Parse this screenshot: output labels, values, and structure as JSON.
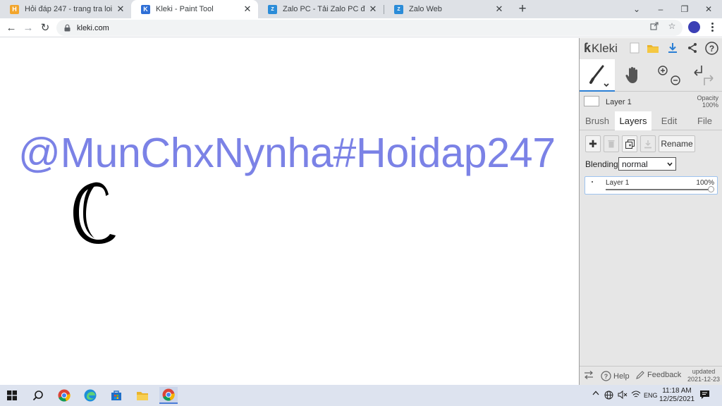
{
  "browser": {
    "tabs": [
      {
        "title": "Hỏi đáp 247 - trang tra loi",
        "active": false,
        "icon": "hoidap-favicon"
      },
      {
        "title": "Kleki - Paint Tool",
        "active": true,
        "icon": "kleki-favicon"
      },
      {
        "title": "Zalo PC - Tải Zalo PC để làm việc",
        "active": false,
        "icon": "zalo-favicon"
      },
      {
        "title": "Zalo Web",
        "active": false,
        "icon": "zalo-favicon"
      }
    ],
    "url": "kleki.com",
    "window_controls": {
      "tab_search": "⌄",
      "minimize": "–",
      "restore": "❐",
      "close": "✕"
    },
    "nav": {
      "back": "←",
      "forward": "→",
      "reload": "↻"
    }
  },
  "canvas": {
    "text": "@MunChxNynha#Hoidap247",
    "text_color": "#7b82e6",
    "stroke_color": "#000000"
  },
  "kleki": {
    "logo_text": "Kleki",
    "header_icons": [
      "new-image-icon",
      "open-folder-icon",
      "download-icon",
      "share-icon",
      "help-icon"
    ],
    "active_layer_name": "Layer 1",
    "opacity_label": "Opacity",
    "opacity_value": "100%",
    "tabs": [
      "Brush",
      "Layers",
      "Edit",
      "File"
    ],
    "active_tab": "Layers",
    "layer_buttons": {
      "rename": "Rename"
    },
    "blending_label": "Blending",
    "blending_value": "normal",
    "layers": [
      {
        "name": "Layer 1",
        "opacity_label": "100%",
        "opacity": 1.0
      }
    ],
    "footer": {
      "help": "Help",
      "feedback": "Feedback",
      "updated_label": "updated",
      "updated_date": "2021-12-23"
    },
    "accent": "#2b7fd4"
  },
  "taskbar": {
    "language": "ENG",
    "time": "11:18 AM",
    "date": "12/25/2021"
  }
}
